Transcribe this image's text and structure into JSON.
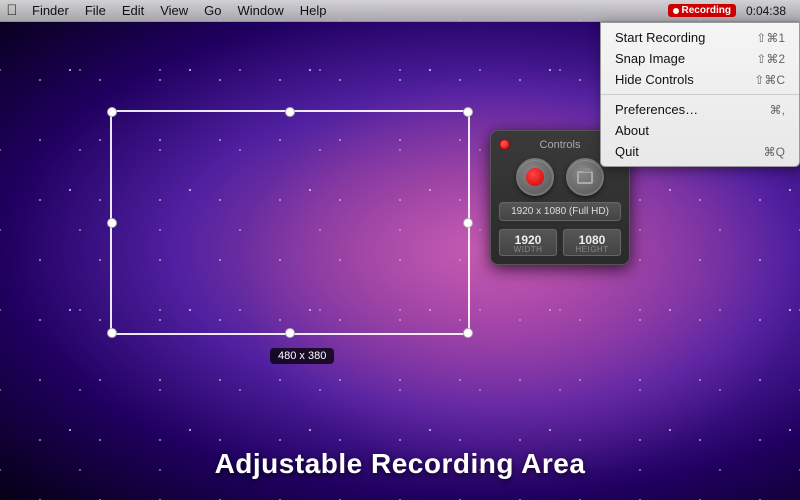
{
  "menubar": {
    "apple": "⌘",
    "items": [
      "Finder",
      "File",
      "Edit",
      "View",
      "Go",
      "Window",
      "Help"
    ]
  },
  "clock": {
    "time": "0:04:38"
  },
  "recording_badge": {
    "label": "Recording"
  },
  "dropdown": {
    "items": [
      {
        "label": "Start Recording",
        "shortcut": "⇧⌘1"
      },
      {
        "label": "Snap Image",
        "shortcut": "⇧⌘2"
      },
      {
        "label": "Hide Controls",
        "shortcut": "⇧⌘C"
      },
      {
        "separator": true
      },
      {
        "label": "Preferences…",
        "shortcut": "⌘,"
      },
      {
        "label": "About",
        "shortcut": ""
      },
      {
        "label": "Quit",
        "shortcut": "⌘Q"
      }
    ]
  },
  "controls": {
    "title": "Controls",
    "resolution": "1920 x 1080 (Full HD)",
    "width_label": "WIDTH",
    "height_label": "HEIGHT",
    "width_value": "1920",
    "height_value": "1080"
  },
  "selection": {
    "size_label": "480 x 380"
  },
  "bottom": {
    "title": "Adjustable Recording Area"
  }
}
